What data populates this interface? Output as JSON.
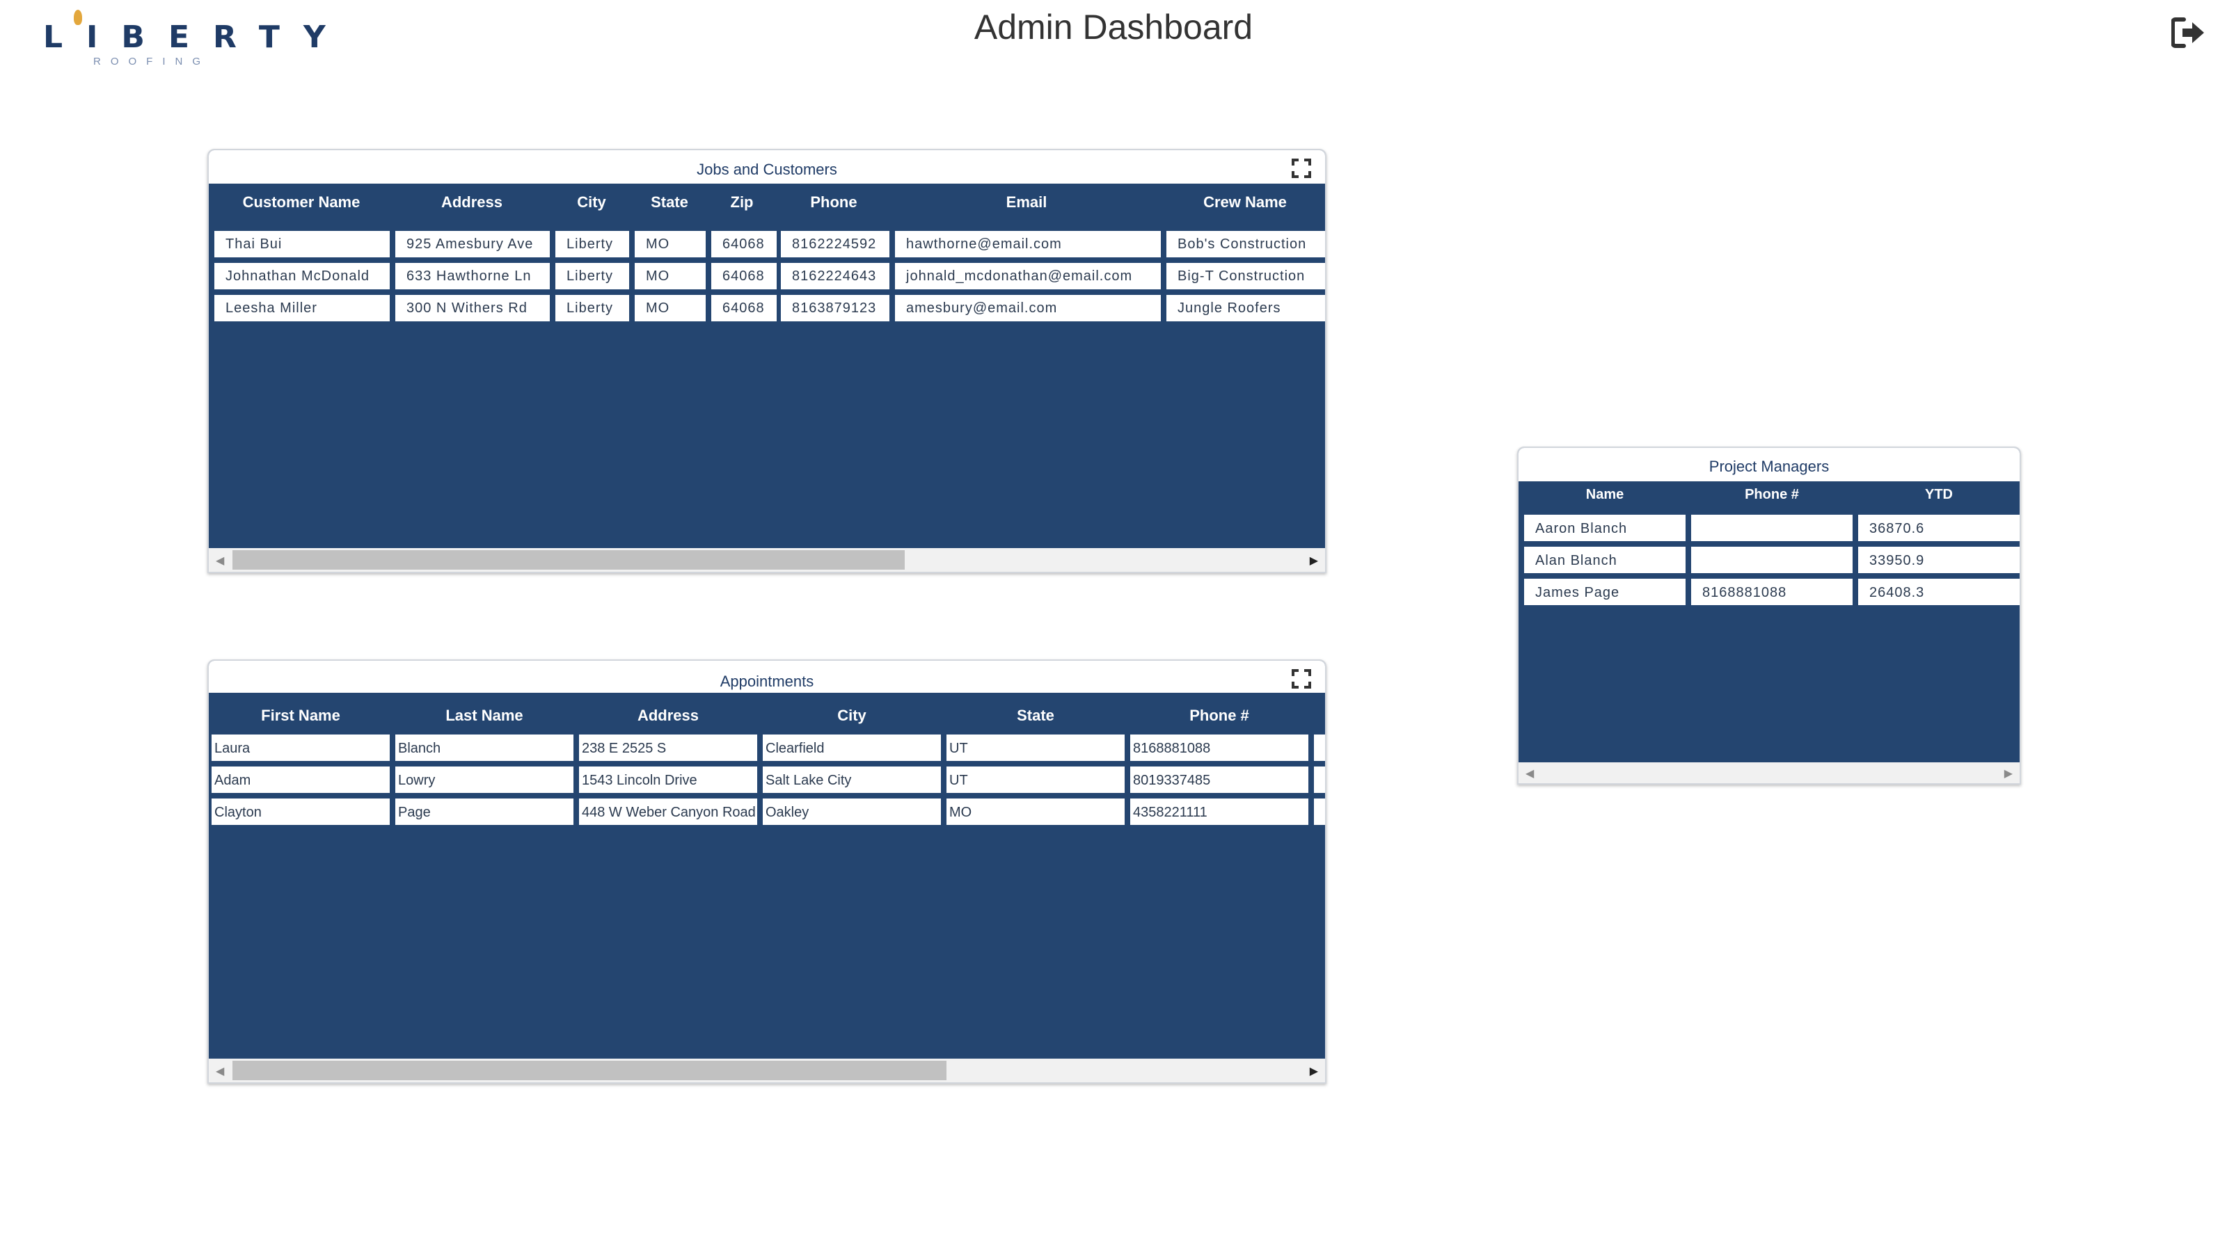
{
  "header": {
    "logo_text": "LIBERTY",
    "logo_subtext": "ROOFING",
    "title": "Admin Dashboard",
    "logout_icon": "logout-icon"
  },
  "jobs": {
    "title": "Jobs and Customers",
    "columns": [
      "Customer Name",
      "Address",
      "City",
      "State",
      "Zip",
      "Phone",
      "Email",
      "Crew Name"
    ],
    "rows": [
      [
        "Thai Bui",
        "925 Amesbury Ave",
        "Liberty",
        "MO",
        "64068",
        "8162224592",
        "hawthorne@email.com",
        "Bob's Construction"
      ],
      [
        "Johnathan McDonald",
        "633 Hawthorne Ln",
        "Liberty",
        "MO",
        "64068",
        "8162224643",
        "johnald_mcdonathan@email.com",
        "Big-T Construction"
      ],
      [
        "Leesha Miller",
        "300 N Withers Rd",
        "Liberty",
        "MO",
        "64068",
        "8163879123",
        "amesbury@email.com",
        "Jungle Roofers"
      ]
    ]
  },
  "appointments": {
    "title": "Appointments",
    "columns": [
      "First Name",
      "Last Name",
      "Address",
      "City",
      "State",
      "Phone #"
    ],
    "rows": [
      [
        "Laura",
        "Blanch",
        "238 E 2525 S",
        "Clearfield",
        "UT",
        "8168881088"
      ],
      [
        "Adam",
        "Lowry",
        "1543 Lincoln Drive",
        "Salt Lake City",
        "UT",
        "8019337485"
      ],
      [
        "Clayton",
        "Page",
        "448 W Weber Canyon Road",
        "Oakley",
        "MO",
        "4358221111"
      ]
    ]
  },
  "project_managers": {
    "title": "Project Managers",
    "columns": [
      "Name",
      "Phone #",
      "YTD"
    ],
    "rows": [
      [
        "Aaron Blanch",
        "",
        "36870.6"
      ],
      [
        "Alan Blanch",
        "",
        "33950.9"
      ],
      [
        "James Page",
        "8168881088",
        "26408.3"
      ]
    ]
  },
  "colors": {
    "panel_bg": "#244570",
    "brand": "#1f3b66",
    "flame": "#e3a73c"
  }
}
